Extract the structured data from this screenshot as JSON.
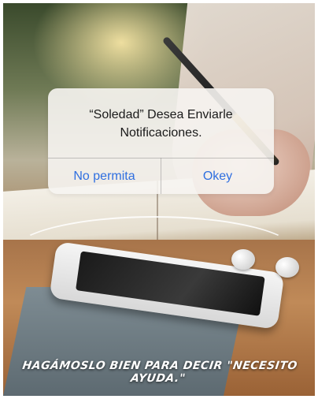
{
  "alert": {
    "title": "“Soledad” Desea Enviarle Notificaciones.",
    "deny_label": "No permita",
    "allow_label": "Okey"
  },
  "caption": "HAGÁMOSLO BIEN PARA DECIR \"NECESITO AYUDA.\"",
  "colors": {
    "button_text": "#2f6fe0",
    "dialog_background": "#f6f4f1"
  }
}
